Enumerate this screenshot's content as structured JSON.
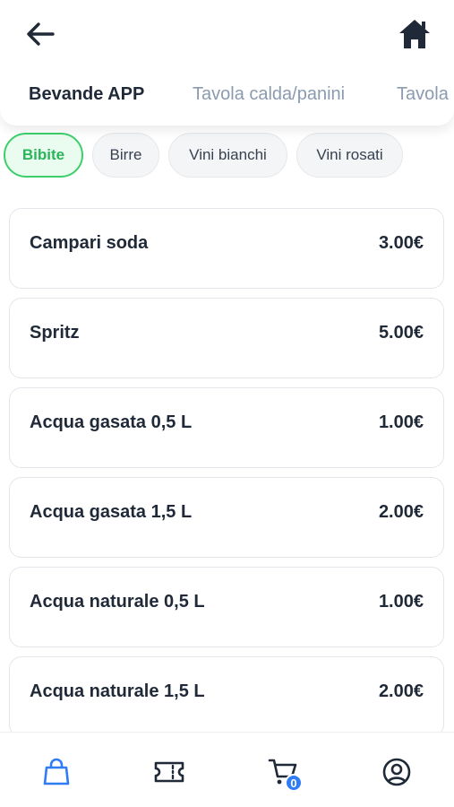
{
  "header": {
    "tabs": [
      {
        "label": "Bevande APP",
        "active": true
      },
      {
        "label": "Tavola calda/panini",
        "active": false
      },
      {
        "label": "Tavola",
        "active": false
      }
    ]
  },
  "chips": [
    {
      "label": "Bibite",
      "active": true
    },
    {
      "label": "Birre",
      "active": false
    },
    {
      "label": "Vini bianchi",
      "active": false
    },
    {
      "label": "Vini rosati",
      "active": false
    }
  ],
  "items": [
    {
      "name": "Campari soda",
      "price": "3.00€"
    },
    {
      "name": "Spritz",
      "price": "5.00€"
    },
    {
      "name": "Acqua gasata 0,5 L",
      "price": "1.00€"
    },
    {
      "name": "Acqua gasata 1,5 L",
      "price": "2.00€"
    },
    {
      "name": "Acqua naturale 0,5 L",
      "price": "1.00€"
    },
    {
      "name": "Acqua naturale 1,5 L",
      "price": "2.00€"
    }
  ],
  "bottom_nav": {
    "items": [
      {
        "icon": "shopping-bag-icon",
        "active": true
      },
      {
        "icon": "ticket-icon",
        "active": false
      },
      {
        "icon": "cart-icon",
        "active": false
      },
      {
        "icon": "user-circle-icon",
        "active": false
      }
    ],
    "cart_count": "0"
  },
  "colors": {
    "accent_green": "#3ccf6b",
    "accent_blue": "#2f7cf6",
    "text_dark": "#1f2937",
    "text_muted": "#8a9bb0"
  }
}
